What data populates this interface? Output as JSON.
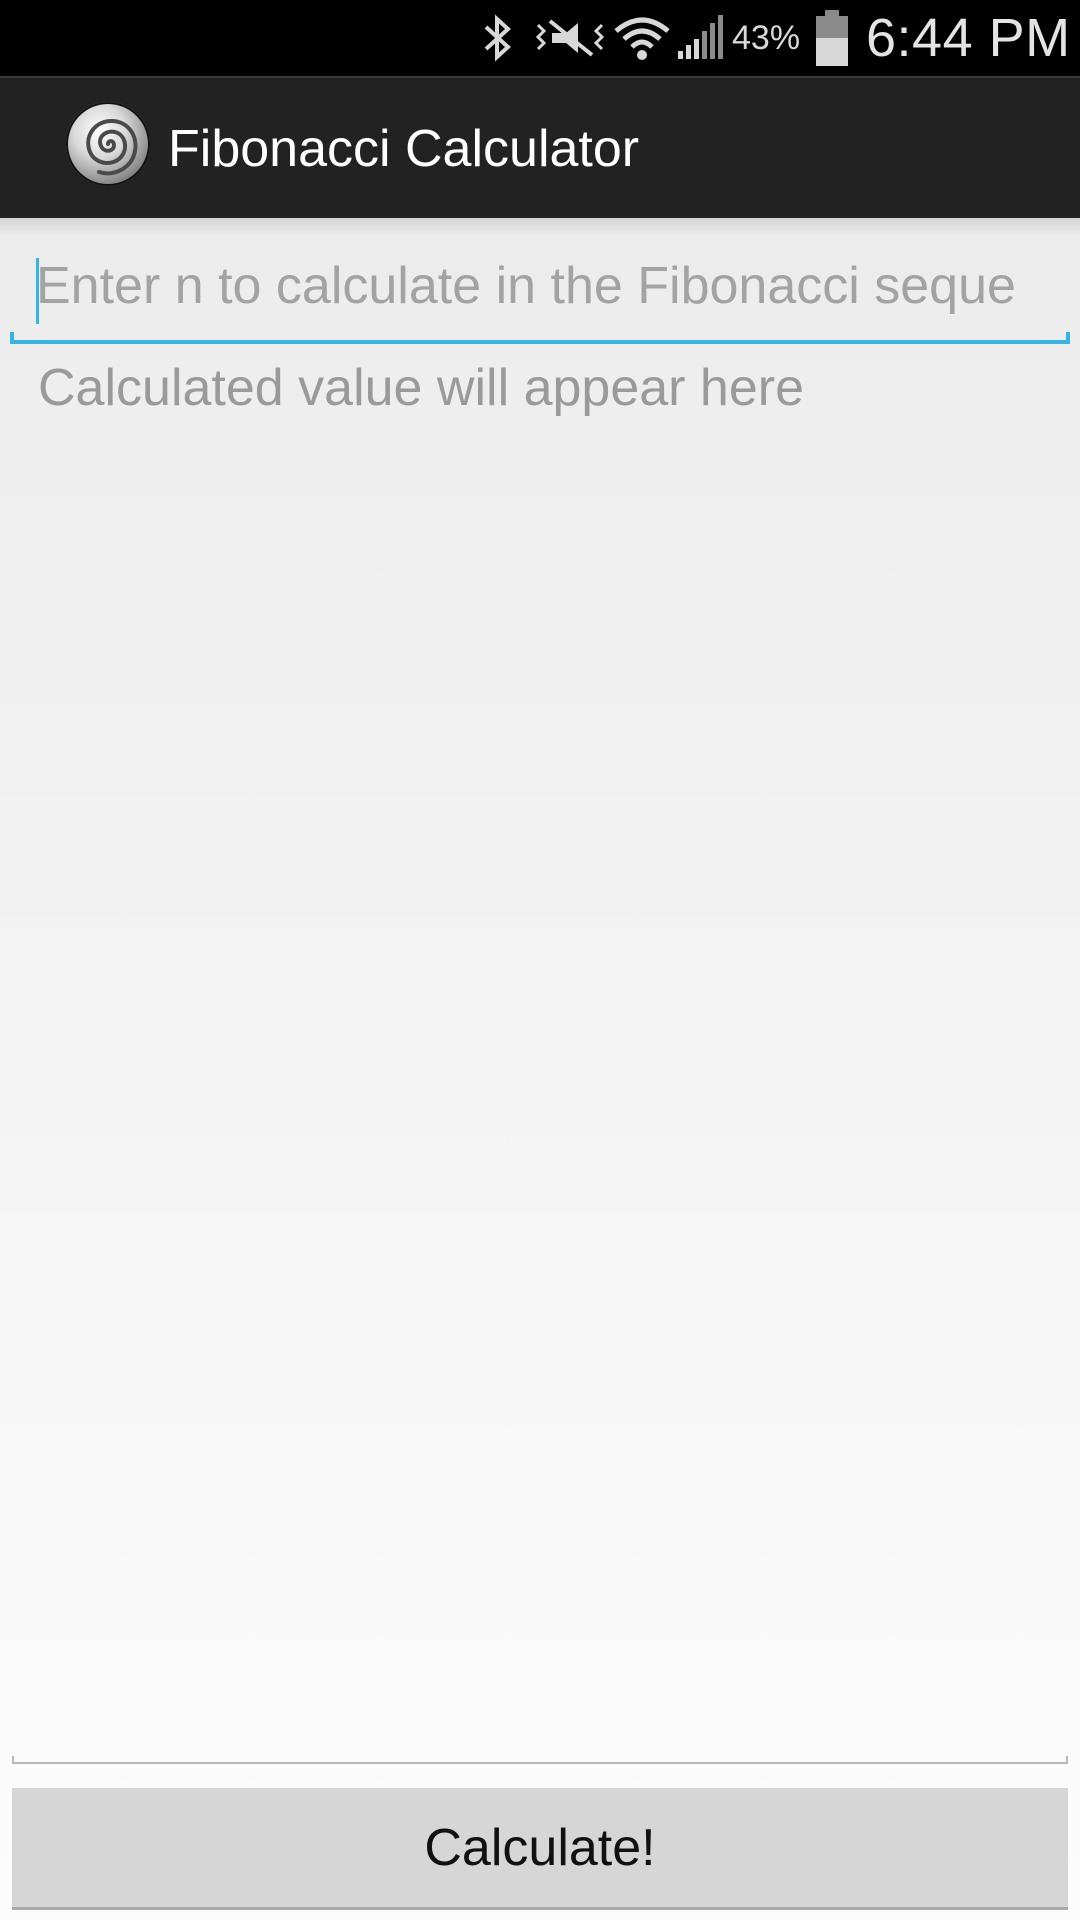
{
  "status_bar": {
    "battery_percent": "43%",
    "time": "6:44 PM",
    "icons": [
      "bluetooth-icon",
      "vibrate-icon",
      "wifi-icon",
      "signal-icon",
      "battery-icon"
    ],
    "battery_level": 0.43
  },
  "action_bar": {
    "title": "Fibonacci Calculator",
    "icon": "spiral-icon"
  },
  "main": {
    "n_input": {
      "placeholder": "Enter n to calculate in the Fibonacci seque",
      "value": ""
    },
    "result_text": "Calculated value will appear here",
    "calculate_button_label": "Calculate!"
  },
  "colors": {
    "accent": "#33b5e5",
    "action_bar_bg": "#222222",
    "status_bar_bg": "#000000",
    "button_bg": "#d6d6d6",
    "placeholder_text": "#a3a3a3"
  }
}
